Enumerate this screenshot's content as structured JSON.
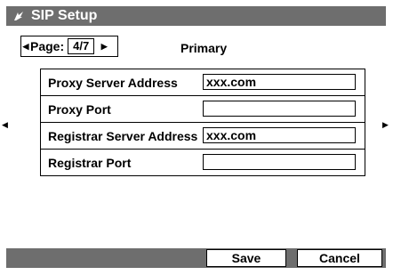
{
  "window": {
    "title": "SIP Setup",
    "title_icon": "gear-icon"
  },
  "pager": {
    "label": "Page:",
    "value": "4/7",
    "prev_icon": "triangle-left-icon",
    "next_icon": "triangle-right-icon"
  },
  "section_title": "Primary",
  "fields": [
    {
      "label": "Proxy Server Address",
      "value": "xxx.com"
    },
    {
      "label": "Proxy Port",
      "value": ""
    },
    {
      "label": "Registrar Server Address",
      "value": "xxx.com"
    },
    {
      "label": "Registrar Port",
      "value": ""
    }
  ],
  "buttons": {
    "save": "Save",
    "cancel": "Cancel"
  },
  "colors": {
    "bar": "#6e6e6e",
    "text": "#000000",
    "title_text": "#ffffff"
  }
}
